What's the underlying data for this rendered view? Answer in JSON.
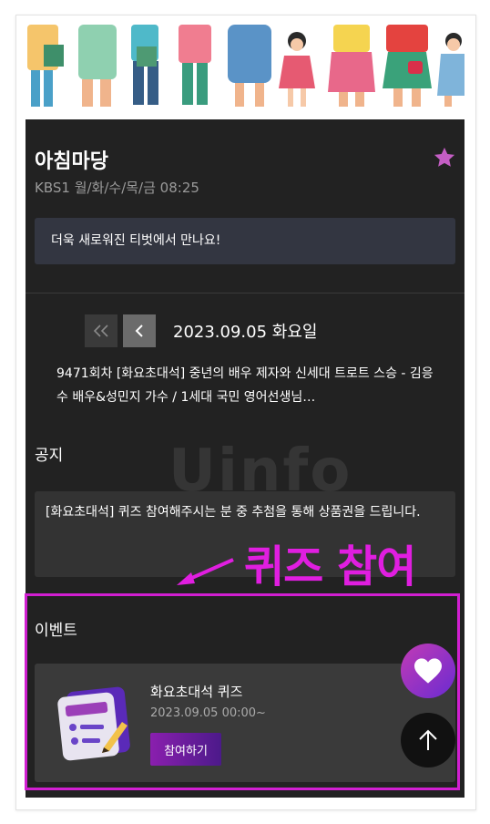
{
  "program": {
    "title": "아침마당",
    "subtitle": "KBS1 월/화/수/목/금 08:25",
    "banner_text": "더욱 새로워진 티벗에서 만나요!"
  },
  "date_nav": {
    "date": "2023.09.05 화요일"
  },
  "episode": {
    "text": "9471회차 [화요초대석] 중년의 배우 제자와 신세대 트로트 스승 - 김응수 배우&성민지 가수 / 1세대 국민 영어선생님…"
  },
  "notice": {
    "heading": "공지",
    "text": "[화요초대석] 퀴즈 참여해주시는 분 중 추첨을 통해 상품권을 드립니다."
  },
  "event": {
    "heading": "이벤트",
    "name": "화요초대석 퀴즈",
    "date": "2023.09.05 00:00~",
    "join_label": "참여하기"
  },
  "annotation": {
    "callout": "퀴즈 참여",
    "watermark": "Uinfo"
  },
  "colors": {
    "accent_purple": "#c23bb5",
    "highlight_magenta": "#d11fd1",
    "star": "#c45ec4"
  },
  "icons": [
    "star-icon",
    "double-chevron-left-icon",
    "chevron-left-icon",
    "quiz-document-icon",
    "heart-icon",
    "arrow-up-icon"
  ]
}
